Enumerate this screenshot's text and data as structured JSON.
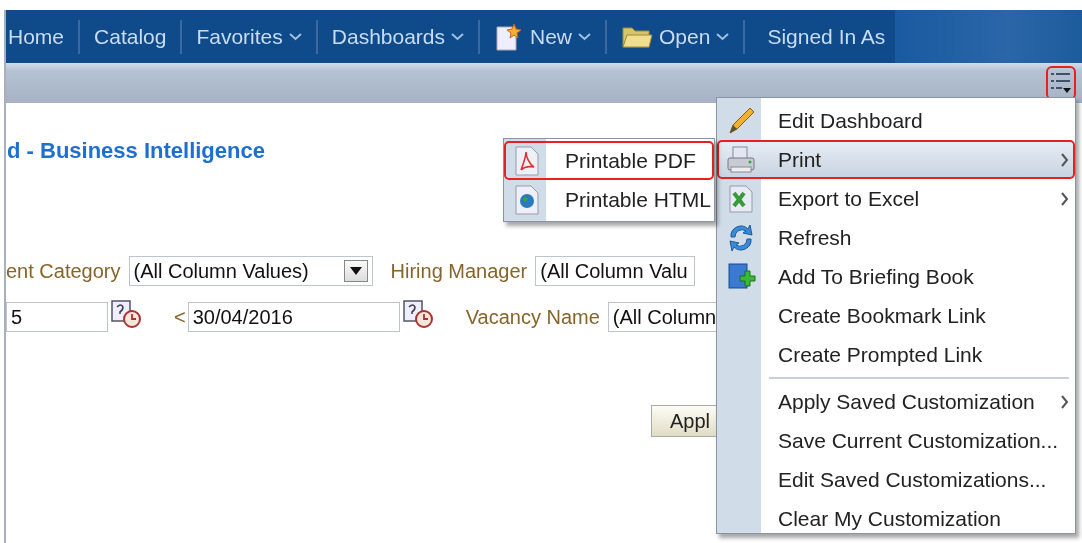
{
  "nav": {
    "items": [
      {
        "label": "Home",
        "dropdown": false
      },
      {
        "label": "Catalog",
        "dropdown": false
      },
      {
        "label": "Favorites",
        "dropdown": true
      },
      {
        "label": "Dashboards",
        "dropdown": true
      },
      {
        "label": "New",
        "kind": "new",
        "dropdown": true
      },
      {
        "label": "Open",
        "kind": "open",
        "dropdown": true
      }
    ],
    "signed_in_label": "Signed In As"
  },
  "toolbar": {
    "page_options_annotated": true
  },
  "page": {
    "title": "d - Business Intelligence",
    "prompt_rows": [
      [
        {
          "label": "ent Category",
          "kind": "dropdown",
          "value": "(All Column Values)"
        },
        {
          "label": "Hiring Manager",
          "kind": "text",
          "value": "(All Column Valu"
        }
      ],
      [
        {
          "kind": "date",
          "value": "5"
        },
        {
          "kind": "date",
          "prefix": "<",
          "value": "30/04/2016"
        },
        {
          "label": "Vacancy Name",
          "kind": "text",
          "value": "(All Column"
        }
      ]
    ],
    "apply_button": "Appl"
  },
  "page_menu": {
    "items": [
      {
        "kind": "item",
        "label": "Edit Dashboard",
        "submenu": false,
        "selected": false,
        "annotated": false
      },
      {
        "kind": "item",
        "label": "Print",
        "submenu": true,
        "selected": true,
        "annotated": true
      },
      {
        "kind": "item",
        "label": "Export to Excel",
        "submenu": true,
        "selected": false,
        "annotated": false
      },
      {
        "kind": "item",
        "label": "Refresh",
        "submenu": false,
        "selected": false,
        "annotated": false
      },
      {
        "kind": "item",
        "label": "Add To Briefing Book",
        "submenu": false,
        "selected": false,
        "annotated": false
      },
      {
        "kind": "item",
        "label": "Create Bookmark Link",
        "submenu": false,
        "selected": false,
        "annotated": false
      },
      {
        "kind": "item",
        "label": "Create Prompted Link",
        "submenu": false,
        "selected": false,
        "annotated": false
      },
      {
        "kind": "separator"
      },
      {
        "kind": "item",
        "label": "Apply Saved Customization",
        "submenu": true,
        "selected": false,
        "annotated": false
      },
      {
        "kind": "item",
        "label": "Save Current Customization...",
        "submenu": false,
        "selected": false,
        "annotated": false
      },
      {
        "kind": "item",
        "label": "Edit Saved Customizations...",
        "submenu": false,
        "selected": false,
        "annotated": false
      },
      {
        "kind": "item",
        "label": "Clear My Customization",
        "submenu": false,
        "selected": false,
        "annotated": false
      }
    ]
  },
  "print_submenu": {
    "items": [
      {
        "label": "Printable PDF",
        "annotated": true
      },
      {
        "label": "Printable HTML",
        "annotated": false
      }
    ]
  }
}
